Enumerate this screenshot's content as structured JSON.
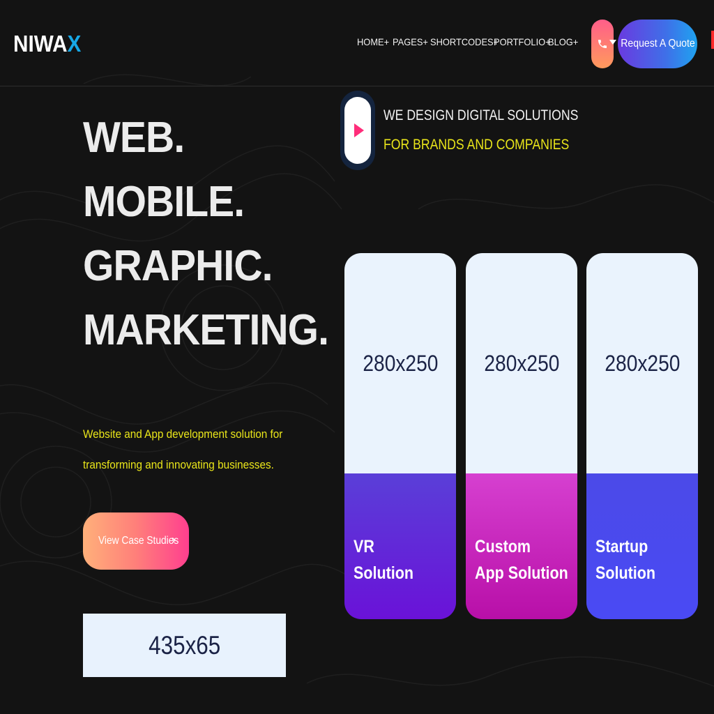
{
  "brand": {
    "logo_main": "NIWA",
    "logo_accent": "X"
  },
  "nav": {
    "items": [
      "HOME+",
      "PAGES+",
      "SHORTCODES+",
      "PORTFOLIO+",
      "BLOG+"
    ]
  },
  "header": {
    "quote_button": "Request A Quote",
    "phone_icon": "phone-icon"
  },
  "hero": {
    "headline": [
      "WEB.",
      "MOBILE.",
      "GRAPHIC.",
      "MARKETING."
    ],
    "tagline_line1": "Website and App development solution for",
    "tagline_line2": "transforming and innovating businesses.",
    "cta_label": "View Case Studies",
    "cta_icon": "›",
    "ad_placeholder": "435x65"
  },
  "intro": {
    "line1": "WE DESIGN DIGITAL SOLUTIONS",
    "line2": "FOR BRANDS AND COMPANIES",
    "play_icon": "play-icon"
  },
  "cards": [
    {
      "placeholder": "280x250",
      "title_line1": "VR",
      "title_line2": "Solution"
    },
    {
      "placeholder": "280x250",
      "title_line1": "Custom",
      "title_line2": "App Solution"
    },
    {
      "placeholder": "280x250",
      "title_line1": "Startup",
      "title_line2": "Solution"
    }
  ],
  "colors": {
    "background": "#131313",
    "accent_yellow": "#e9e51a",
    "logo_accent": "#17a8e6",
    "card_vr": "#6a12d8",
    "card_app": "#c220b8",
    "card_startup": "#4a4af0"
  }
}
